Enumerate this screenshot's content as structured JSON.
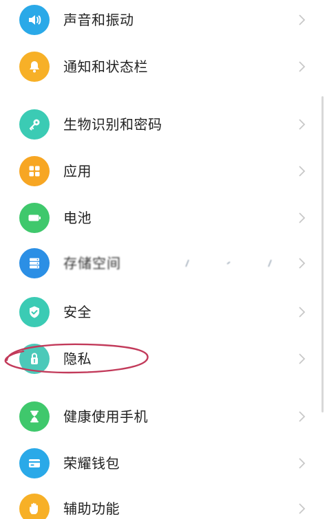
{
  "settings": {
    "items": [
      {
        "label": "声音和振动",
        "icon": "speaker-icon",
        "color": "#2aa9e8"
      },
      {
        "label": "通知和状态栏",
        "icon": "bell-icon",
        "color": "#f7b027"
      },
      {
        "label": "生物识别和密码",
        "icon": "key-icon",
        "color": "#3bcbb4"
      },
      {
        "label": "应用",
        "icon": "apps-grid-icon",
        "color": "#f7a623"
      },
      {
        "label": "电池",
        "icon": "battery-icon",
        "color": "#3fc86c"
      },
      {
        "label": "存储空间",
        "icon": "storage-icon",
        "color": "#2b8fe5"
      },
      {
        "label": "安全",
        "icon": "shield-check-icon",
        "color": "#3bcbb4"
      },
      {
        "label": "隐私",
        "icon": "privacy-lock-icon",
        "color": "#4cc9b9"
      },
      {
        "label": "健康使用手机",
        "icon": "hourglass-icon",
        "color": "#3fc86c"
      },
      {
        "label": "荣耀钱包",
        "icon": "wallet-icon",
        "color": "#2aa9e8"
      },
      {
        "label": "辅助功能",
        "icon": "hand-icon",
        "color": "#f7b027"
      }
    ]
  },
  "annotation": {
    "color": "#c23a5a",
    "target": "隐私"
  }
}
